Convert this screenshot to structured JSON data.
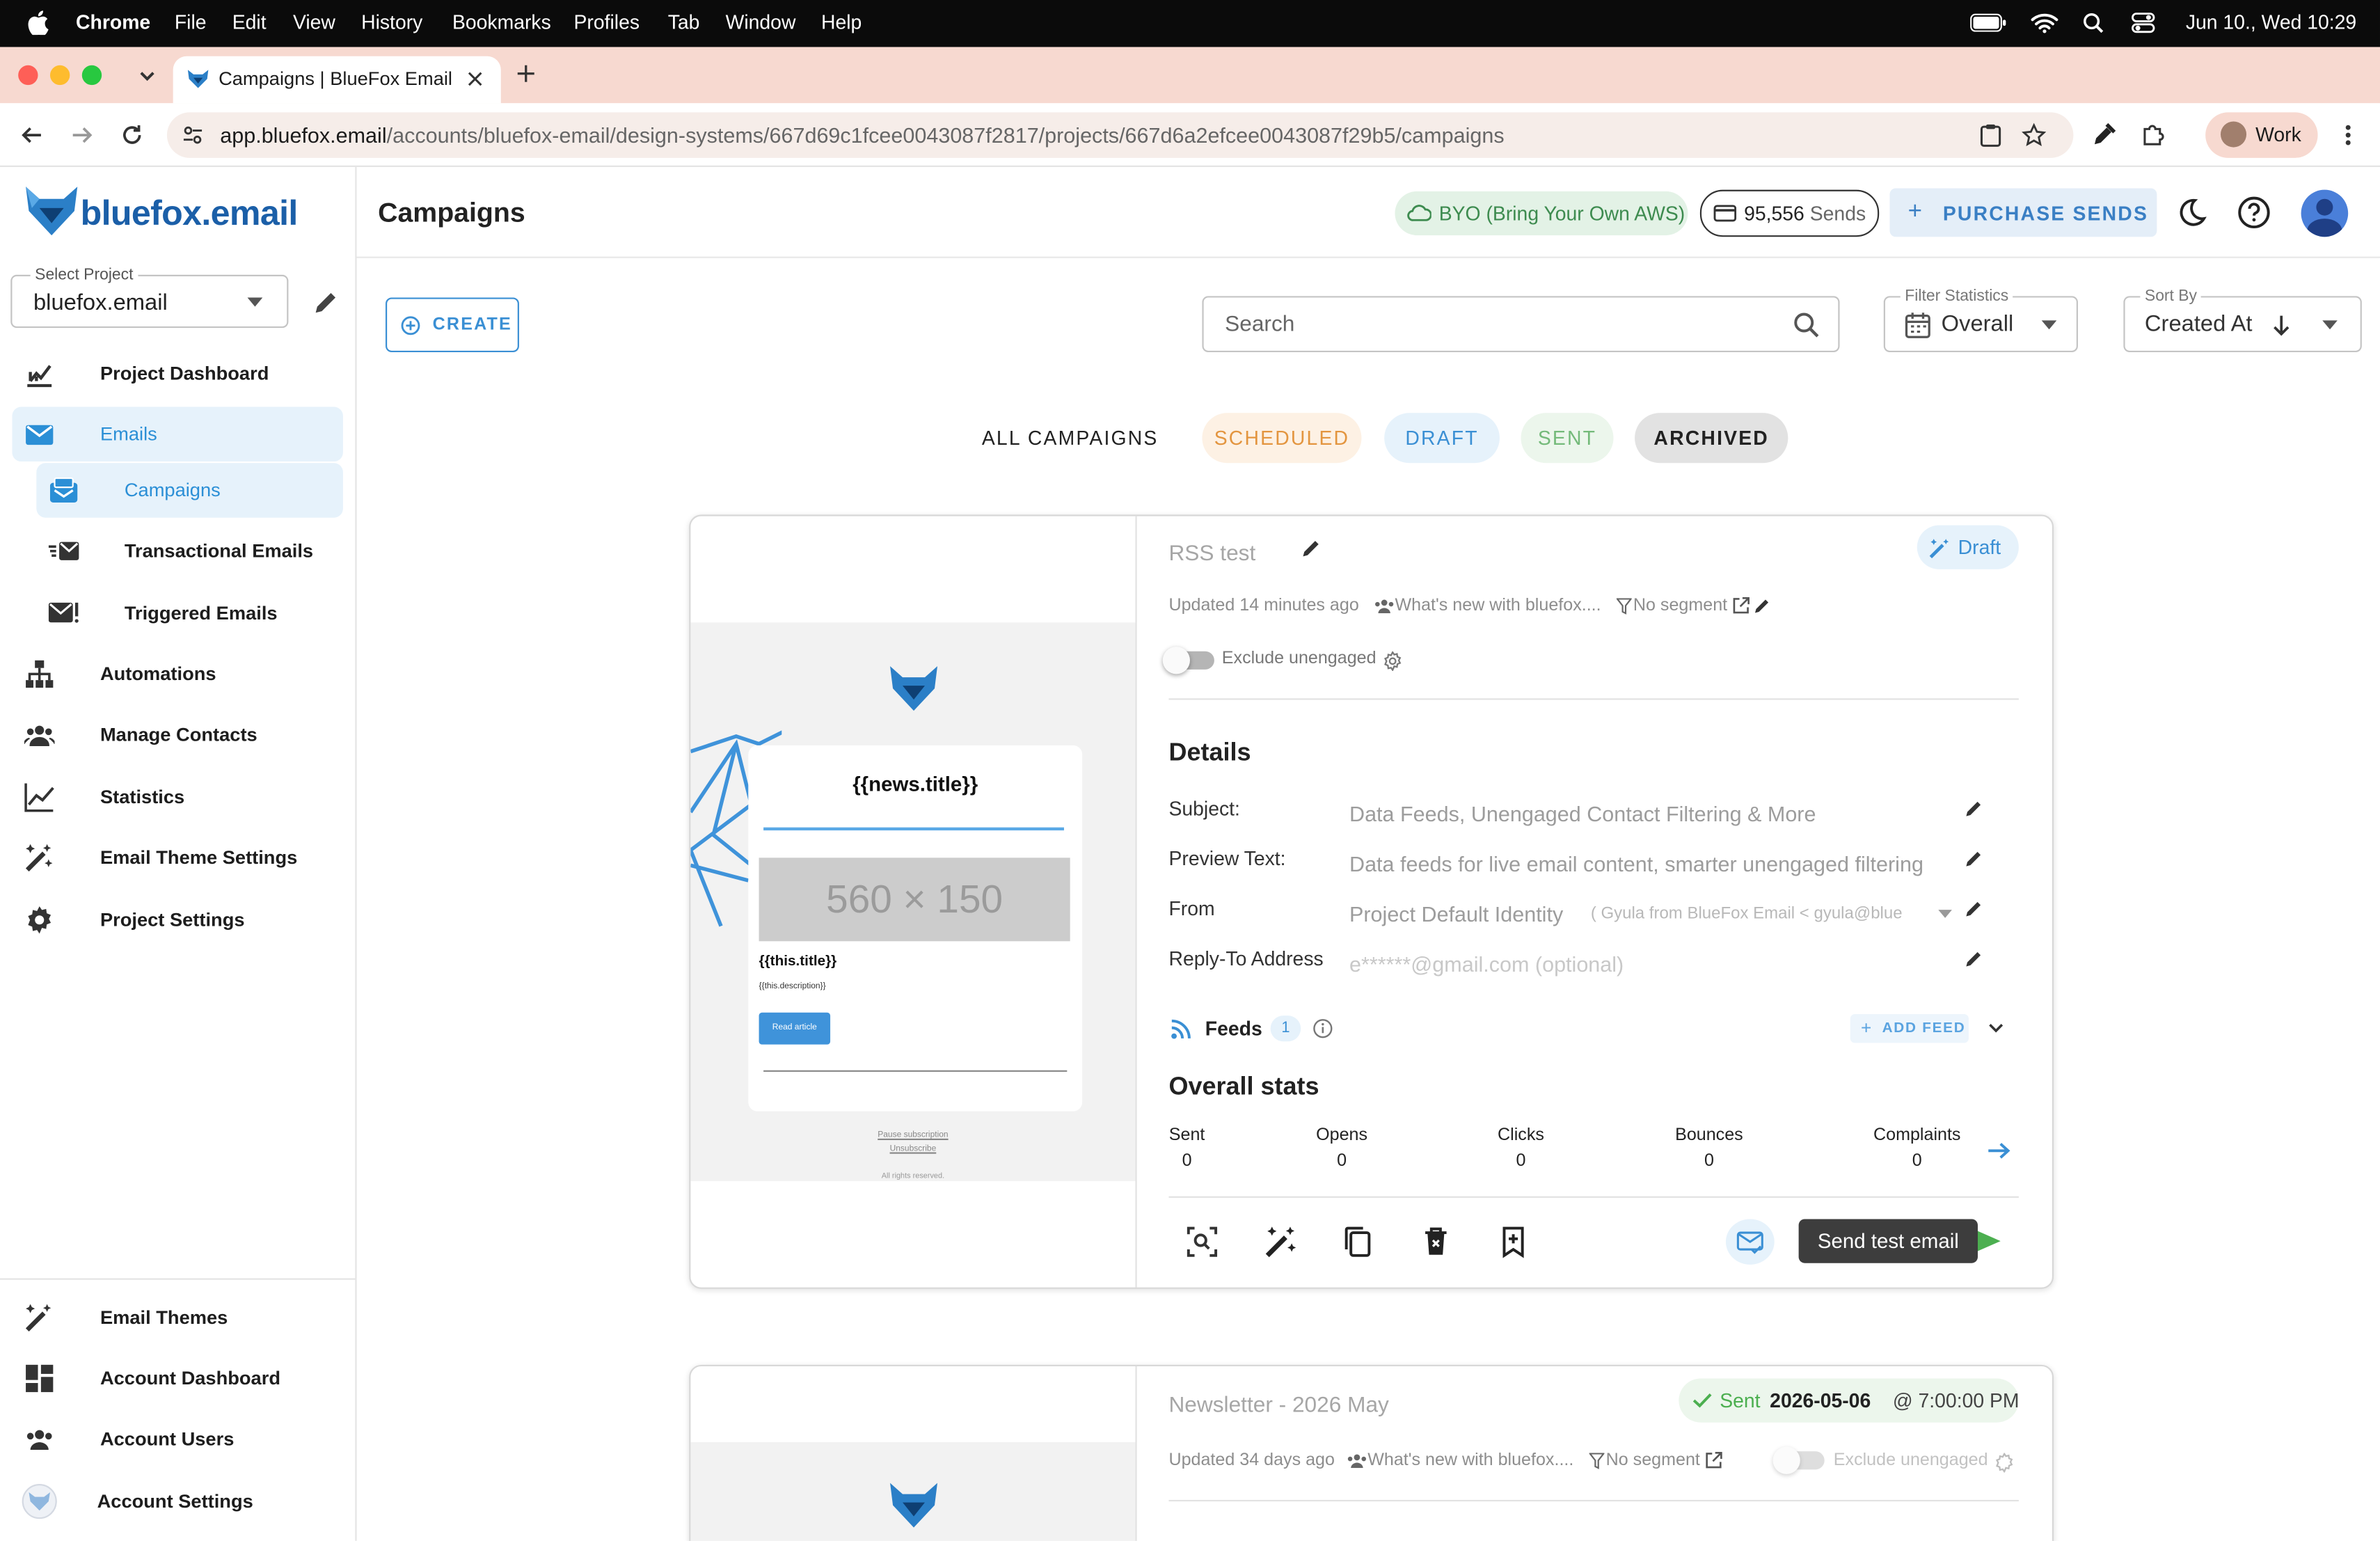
{
  "menubar": {
    "app": "Chrome",
    "items": [
      "File",
      "Edit",
      "View",
      "History",
      "Bookmarks",
      "Profiles",
      "Tab",
      "Window",
      "Help"
    ],
    "datetime": "Jun 10., Wed  10:29"
  },
  "browser": {
    "tab_title": "Campaigns | BlueFox Email",
    "url_host": "app.bluefox.email",
    "url_path": "/accounts/bluefox-email/design-systems/667d69c1fcee0043087f2817/projects/667d6a2efcee0043087f29b5/campaigns",
    "profile": "Work"
  },
  "brand": {
    "logo_text": "bluefox.email",
    "accent": "#2b8fd6"
  },
  "project_select": {
    "label": "Select Project",
    "value": "bluefox.email"
  },
  "nav": {
    "items": [
      {
        "label": "Project Dashboard",
        "icon": "chart-icon"
      },
      {
        "label": "Emails",
        "icon": "mail-icon",
        "active": true
      },
      {
        "label": "Campaigns",
        "icon": "campaign-icon",
        "active": true,
        "sub": true
      },
      {
        "label": "Transactional Emails",
        "icon": "transactional-icon",
        "sub": true
      },
      {
        "label": "Triggered Emails",
        "icon": "triggered-icon",
        "sub": true
      },
      {
        "label": "Automations",
        "icon": "sitemap-icon"
      },
      {
        "label": "Manage Contacts",
        "icon": "people-icon"
      },
      {
        "label": "Statistics",
        "icon": "line-chart-icon"
      },
      {
        "label": "Email Theme Settings",
        "icon": "wand-icon"
      },
      {
        "label": "Project Settings",
        "icon": "gear-icon"
      }
    ],
    "bottom": [
      {
        "label": "Email Themes",
        "icon": "wand-icon"
      },
      {
        "label": "Account Dashboard",
        "icon": "dashboard-icon"
      },
      {
        "label": "Account Users",
        "icon": "people-icon"
      },
      {
        "label": "Account Settings",
        "icon": "account-settings-icon"
      }
    ]
  },
  "header": {
    "title": "Campaigns",
    "byo": "BYO (Bring Your Own AWS)",
    "sends_count": "95,556",
    "sends_label": "Sends",
    "purchase": "PURCHASE SENDS"
  },
  "toolbar": {
    "create": "CREATE",
    "search_placeholder": "Search",
    "filter_label": "Filter Statistics",
    "filter_value": "Overall",
    "sort_label": "Sort By",
    "sort_value": "Created At"
  },
  "filter_tabs": [
    "ALL CAMPAIGNS",
    "SCHEDULED",
    "DRAFT",
    "SENT",
    "ARCHIVED"
  ],
  "card1": {
    "name": "RSS test",
    "status": "Draft",
    "updated": "Updated 14 minutes ago",
    "list": "What's new with bluefox....",
    "segment": "No segment",
    "exclude": "Exclude unengaged",
    "details_title": "Details",
    "details": [
      {
        "label": "Subject:",
        "value": "Data Feeds, Unengaged Contact Filtering & More"
      },
      {
        "label": "Preview Text:",
        "value": "Data feeds for live email content, smarter unengaged filtering"
      },
      {
        "label": "From",
        "value": "Project Default Identity",
        "extra": "( Gyula from BlueFox Email < gyula@blue"
      },
      {
        "label": "Reply-To Address",
        "value": "e******@gmail.com (optional)"
      }
    ],
    "feeds_label": "Feeds",
    "feeds_count": "1",
    "add_feed": "ADD FEED",
    "stats_title": "Overall stats",
    "stats": [
      {
        "label": "Sent",
        "value": "0"
      },
      {
        "label": "Opens",
        "value": "0"
      },
      {
        "label": "Clicks",
        "value": "0"
      },
      {
        "label": "Bounces",
        "value": "0"
      },
      {
        "label": "Complaints",
        "value": "0"
      }
    ],
    "tooltip": "Send test email",
    "preview": {
      "title": "{{news.title}}",
      "placeholder": "560 × 150",
      "item_title": "{{this.title}}",
      "item_desc": "{{this.description}}",
      "read": "Read article",
      "pause": "Pause subscription",
      "unsub": "Unsubscribe",
      "rights": "All rights reserved."
    }
  },
  "card2": {
    "name": "Newsletter - 2026 May",
    "status": "Sent",
    "date": "2026-05-06",
    "time": "@ 7:00:00 PM",
    "updated": "Updated 34 days ago",
    "list": "What's new with bluefox....",
    "segment": "No segment",
    "exclude": "Exclude unengaged"
  }
}
